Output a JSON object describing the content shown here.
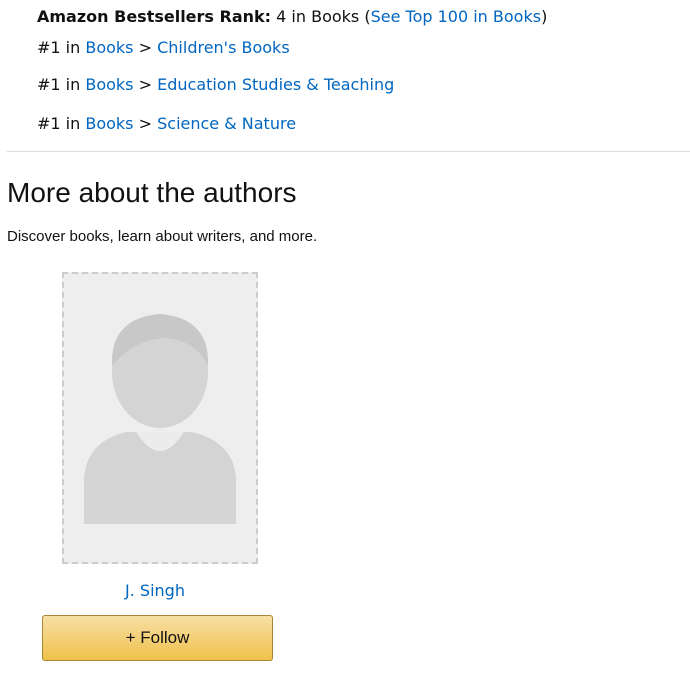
{
  "rank": {
    "label": "Amazon Bestsellers Rank:",
    "value": "4 in Books",
    "open_paren": "(",
    "top100_link": "See Top 100 in Books",
    "close_paren": ")"
  },
  "sub_ranks": [
    {
      "position": "#1 in",
      "category": "Books",
      "separator": ">",
      "subcategory": "Children's Books"
    },
    {
      "position": "#1 in",
      "category": "Books",
      "separator": ">",
      "subcategory": "Education Studies & Teaching"
    },
    {
      "position": "#1 in",
      "category": "Books",
      "separator": ">",
      "subcategory": "Science & Nature"
    }
  ],
  "authors_section": {
    "title": "More about the authors",
    "subtitle": "Discover books, learn about writers, and more.",
    "authors": [
      {
        "name": "J. Singh",
        "photo_icon": "person-silhouette-icon",
        "follow_label": "+ Follow"
      }
    ]
  },
  "colors": {
    "link": "#0066c0",
    "text": "#111111",
    "divider": "#dddddd",
    "photo_bg": "#eeeeee",
    "silhouette": "#d4d4d4",
    "button_top": "#f7dfa5",
    "button_bottom": "#f0c14b",
    "button_border": "#a88734"
  }
}
